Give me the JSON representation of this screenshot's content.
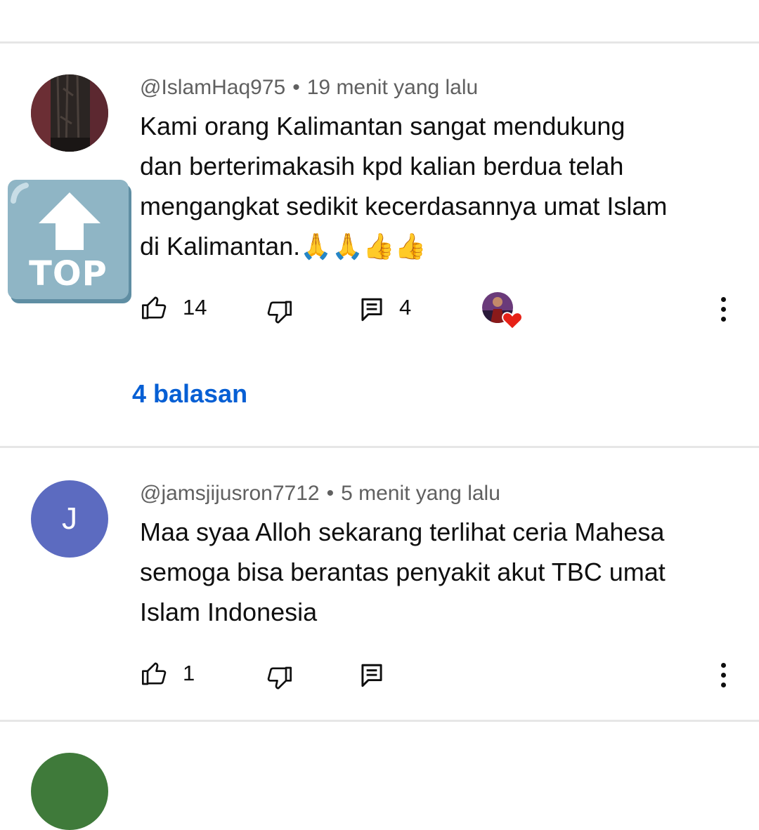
{
  "top_button": {
    "label": "TOP"
  },
  "comments": [
    {
      "handle": "@IslamHaq975",
      "separator": "•",
      "time": "19 menit yang lalu",
      "text_lines": [
        "Kami orang Kalimantan sangat mendukung",
        "dan berterimakasih kpd kalian berdua telah",
        "mengangkat sedikit kecerdasannya umat Islam",
        "di Kalimantan.🙏🙏👍👍"
      ],
      "like_count": "14",
      "reply_count": "4",
      "replies_link": "4 balasan"
    },
    {
      "handle": "@jamsjijusron7712",
      "separator": "•",
      "time": "5 menit yang lalu",
      "avatar_letter": "J",
      "text_lines": [
        "Maa syaa Alloh sekarang terlihat ceria Mahesa",
        "semoga bisa berantas penyakit akut TBC umat",
        "Islam Indonesia"
      ],
      "like_count": "1"
    }
  ],
  "colors": {
    "link": "#065fd4",
    "meta": "#606060",
    "avatar_j": "#5c6bc0",
    "heart": "#e62117"
  }
}
